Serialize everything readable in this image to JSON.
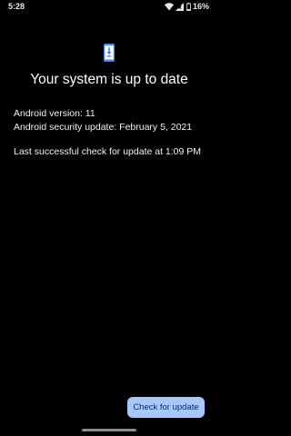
{
  "status_bar": {
    "time": "5:28",
    "battery_percent": "16%",
    "icons": [
      "wifi-icon",
      "signal-icon",
      "battery-icon"
    ]
  },
  "update_screen": {
    "icon": "system-update-icon",
    "title": "Your system is up to date",
    "android_version": "Android version: 11",
    "security_update": "Android security update: February 5, 2021",
    "last_check": "Last successful check for update at 1:09 PM",
    "check_button_label": "Check for update"
  },
  "colors": {
    "background": "#000000",
    "accent_icon": "#4285f4",
    "button_background": "#a8c7fa",
    "button_text": "#062e6f"
  }
}
